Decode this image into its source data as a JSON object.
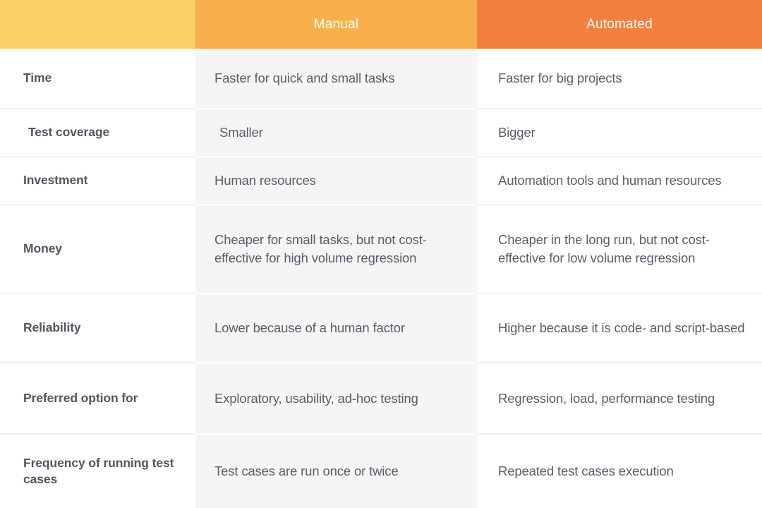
{
  "table": {
    "headers": {
      "corner": "",
      "manual": "Manual",
      "automated": "Automated"
    },
    "colors": {
      "header_corner": "#fccf65",
      "header_manual": "#f7b04c",
      "header_automated": "#f2813f",
      "manual_column_bg": "#f5f5f5",
      "automated_column_bg": "#ffffff",
      "label_text": "#545563",
      "body_text": "#5b5c6b",
      "divider": "#f1f1f2"
    },
    "rows": [
      {
        "label": "Time",
        "manual": "Faster for quick and small tasks",
        "automated": "Faster for big projects"
      },
      {
        "label": "Test coverage",
        "manual": "Smaller",
        "automated": "Bigger"
      },
      {
        "label": "Investment",
        "manual": "Human resources",
        "automated": "Automation tools and human resources"
      },
      {
        "label": "Money",
        "manual": "Cheaper for small tasks, but not cost-effective for high volume regression",
        "automated": "Cheaper in the long run, but not cost-effective for low volume regression"
      },
      {
        "label": "Reliability",
        "manual": "Lower because of a human factor",
        "automated": "Higher because it is code- and script-based"
      },
      {
        "label": "Preferred option for",
        "manual": "Exploratory, usability, ad-hoc testing",
        "automated": "Regression, load, performance testing"
      },
      {
        "label": "Frequency of running test cases",
        "manual": "Test cases are run once or twice",
        "automated": "Repeated test cases execution"
      }
    ]
  }
}
